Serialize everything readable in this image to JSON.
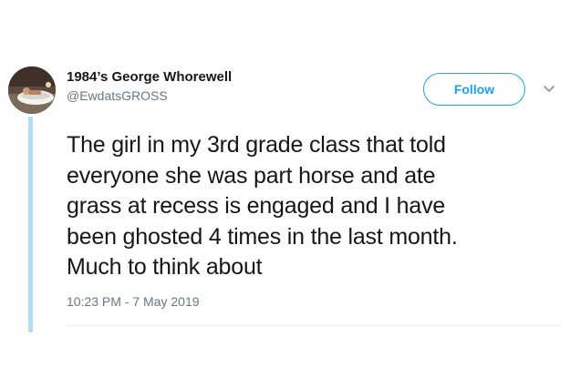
{
  "author": {
    "display_name": "1984’s George Whorewell",
    "handle": "@EwdatsGROSS",
    "avatar_icon": "profile-photo"
  },
  "follow_button": {
    "label": "Follow",
    "color": "#1da1f2"
  },
  "menu_icon": "chevron-down-icon",
  "tweet": {
    "lines": [
      "The girl in my 3rd grade class that told",
      "everyone she was part horse and ate",
      "grass at recess is engaged and I have",
      "been ghosted 4 times in the last month.",
      "Much to think about"
    ],
    "timestamp": "10:23 PM - 7 May 2019"
  },
  "colors": {
    "text": "#14171a",
    "secondary": "#657786",
    "thread_line": "#aeddf5"
  }
}
